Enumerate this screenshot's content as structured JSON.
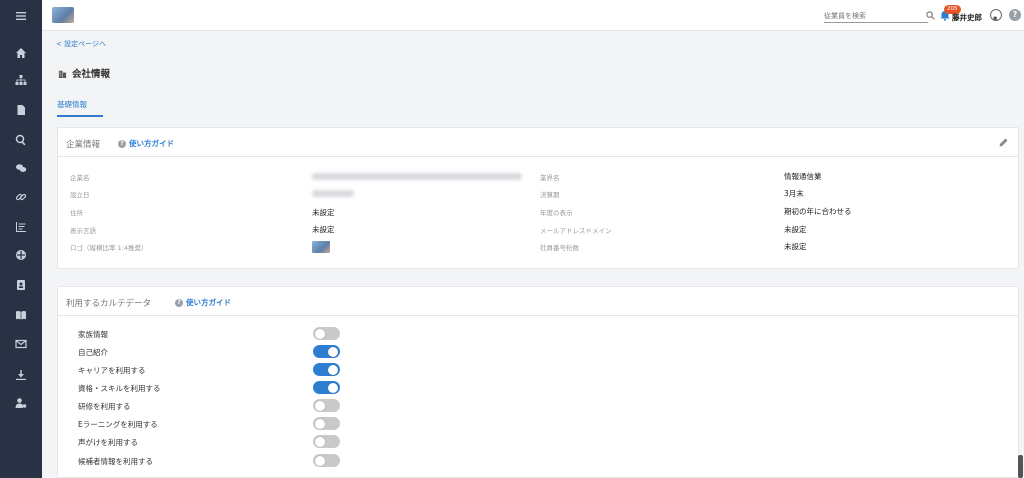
{
  "header": {
    "search_placeholder": "従業員を検索",
    "notification_count": "205",
    "user_name": "藤井史郎",
    "help_label": "?"
  },
  "nav": {
    "back_link": "< 設定ページへ",
    "page_title": "会社情報",
    "tab": "基礎情報"
  },
  "company_card": {
    "title": "企業情報",
    "guide": "使い方ガイド",
    "labels": [
      "企業名",
      "設立日",
      "住所",
      "表示言語",
      "ロゴ（縦横比率 1:4推奨）"
    ],
    "values": [
      "",
      "",
      "未設定",
      "未設定",
      ""
    ],
    "labels_right": [
      "業界名",
      "決算期",
      "年度の表示",
      "メールアドレスドメイン",
      "社員番号桁数"
    ],
    "values_right": [
      "情報通信業",
      "3月末",
      "期初の年に合わせる",
      "未設定",
      "未設定"
    ]
  },
  "karte_card": {
    "title": "利用するカルテデータ",
    "guide": "使い方ガイド",
    "items": [
      {
        "label": "家族情報",
        "on": false
      },
      {
        "label": "自己紹介",
        "on": true
      },
      {
        "label": "キャリアを利用する",
        "on": true
      },
      {
        "label": "資格・スキルを利用する",
        "on": true
      },
      {
        "label": "研修を利用する",
        "on": false
      },
      {
        "label": "Eラーニングを利用する",
        "on": false
      },
      {
        "label": "声がけを利用する",
        "on": false
      },
      {
        "label": "候補者情報を利用する",
        "on": false
      }
    ]
  },
  "colors": {
    "accent": "#2d7ed1",
    "sidebar": "#283244",
    "badge": "#e8532a"
  }
}
